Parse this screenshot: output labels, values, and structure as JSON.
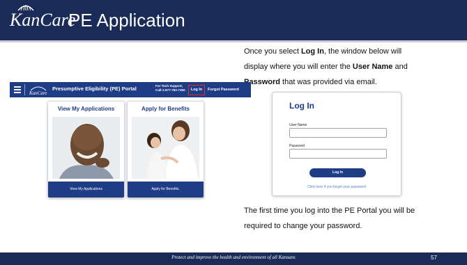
{
  "header": {
    "logo_text": "KanCare",
    "title": "PE Application"
  },
  "instructions": {
    "line1_a": "Once you select ",
    "line1_b": "Log In",
    "line1_c": ", the window below will",
    "line2_a": "display where you will enter the ",
    "line2_b": "User Name",
    "line2_c": " and",
    "line3_a": "Password",
    "line3_b": " that was provided via email.",
    "note_line1": "The first time you log into the PE Portal you will be",
    "note_line2": "required to change your password."
  },
  "portal": {
    "title": "Presumptive Eligibility (PE) Portal",
    "support": "For Tech Support,\nCall:1-877-782-7350",
    "login": "Log In",
    "forgot": "Forgot Password",
    "cards": [
      {
        "title": "View My Applications",
        "button": "View My Applications"
      },
      {
        "title": "Apply for Benefits",
        "button": "Apply for Benefits."
      }
    ]
  },
  "login_box": {
    "title": "Log In",
    "username_label": "User Name",
    "password_label": "Password",
    "button": "Log In",
    "forgot_link": "Click here if you forgot your password"
  },
  "footer": {
    "tagline": "Protect and improve the health and environment of all Kansans",
    "page": "57"
  },
  "colors": {
    "header_bg": "#1a2b57",
    "portal_blue": "#1f3c86",
    "highlight_red": "#e03030"
  }
}
